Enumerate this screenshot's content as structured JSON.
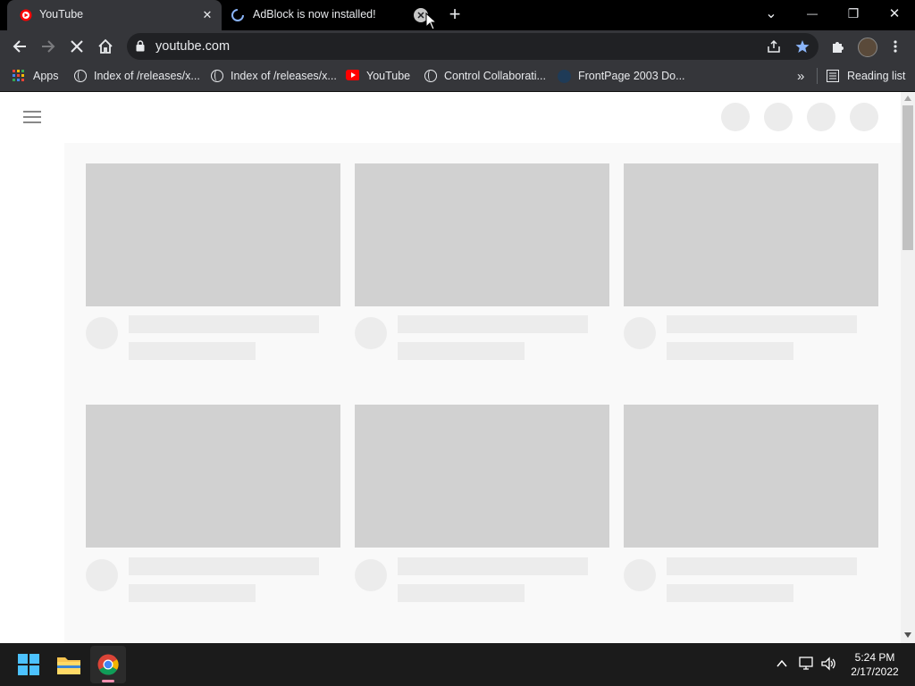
{
  "tabs": [
    {
      "title": "YouTube",
      "close": "✕"
    },
    {
      "title": "AdBlock is now installed!",
      "close": "✕"
    }
  ],
  "new_tab": "+",
  "window_controls": {
    "tab_search": "⌄",
    "minimize": "—",
    "restore": "❐",
    "close": "✕"
  },
  "address_bar": {
    "url": "youtube.com"
  },
  "bookmarks": [
    {
      "label": "Apps",
      "icon": "apps-grid-icon"
    },
    {
      "label": "Index of /releases/x...",
      "icon": "globe-icon"
    },
    {
      "label": "Index of /releases/x...",
      "icon": "globe-icon"
    },
    {
      "label": "YouTube",
      "icon": "youtube-icon"
    },
    {
      "label": "Control Collaborati...",
      "icon": "globe-icon"
    },
    {
      "label": "FrontPage 2003 Do...",
      "icon": "frontpage-icon"
    }
  ],
  "bookmarks_overflow": "»",
  "reading_list": "Reading list",
  "clock": {
    "time": "5:24 PM",
    "date": "2/17/2022"
  },
  "colors": {
    "chrome_dark": "#35363a",
    "tabstrip": "#000000",
    "skeleton": "#d1d1d1",
    "skeleton_light": "#ececec",
    "star": "#8ab4f8",
    "youtube_red": "#ff0000"
  }
}
